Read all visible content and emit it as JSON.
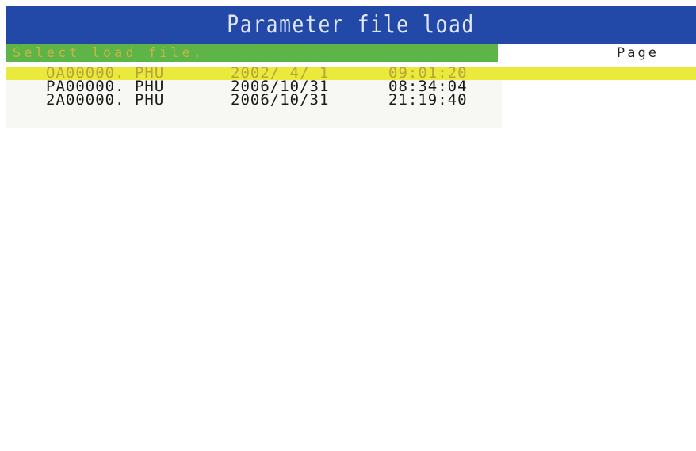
{
  "window": {
    "title": "Parameter file load"
  },
  "prompt": {
    "text": "Select load file."
  },
  "page": {
    "label": "Page"
  },
  "files": [
    {
      "name": "OA00000. PHU",
      "date": "2002/ 4/ 1",
      "time": "09:01:20",
      "selected": true
    },
    {
      "name": "PA00000. PHU",
      "date": "2006/10/31",
      "time": "08:34:04",
      "selected": false
    },
    {
      "name": "2A00000. PHU",
      "date": "2006/10/31",
      "time": "21:19:40",
      "selected": false
    }
  ],
  "colors": {
    "title_bar": "#2248a8",
    "prompt_bar": "#5cb546",
    "selection": "#eaea3c",
    "selected_text": "#b9a33a"
  }
}
